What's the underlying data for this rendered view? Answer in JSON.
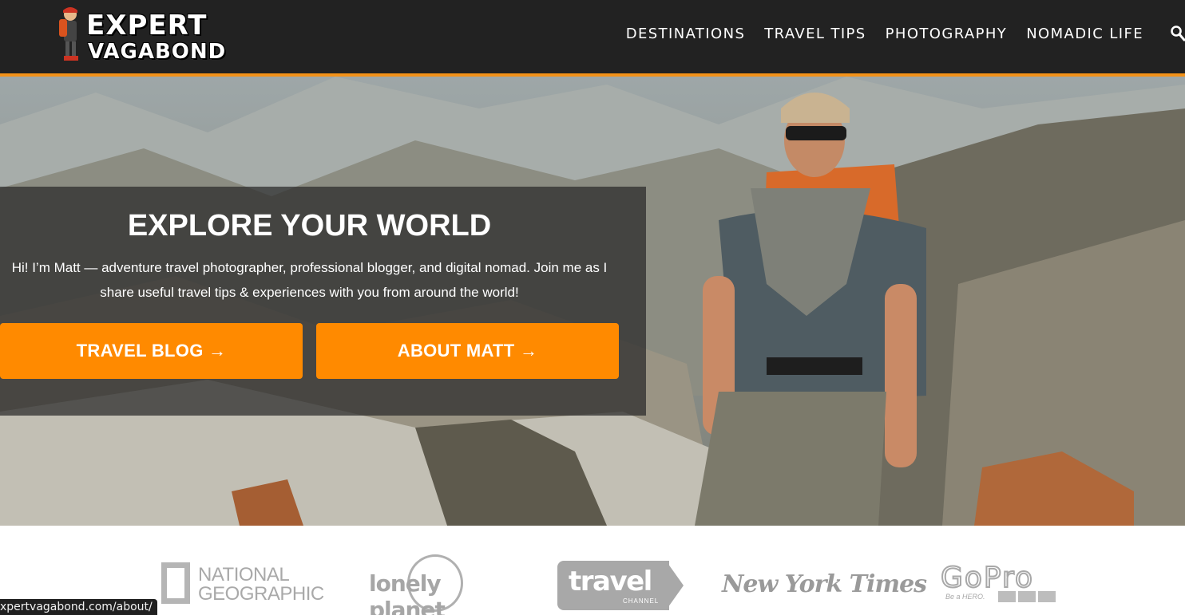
{
  "header": {
    "logo": {
      "line1": "EXPERT",
      "line2": "VAGABOND"
    },
    "nav": [
      {
        "label": "DESTINATIONS"
      },
      {
        "label": "TRAVEL TIPS"
      },
      {
        "label": "PHOTOGRAPHY"
      },
      {
        "label": "NOMADIC LIFE"
      }
    ],
    "search_icon": "search-icon"
  },
  "hero": {
    "title": "EXPLORE YOUR WORLD",
    "text": "Hi! I’m Matt — adventure travel photographer, professional blogger, and digital nomad. Join me as I share useful travel tips & experiences with you from around the world!",
    "buttons": {
      "blog": "TRAVEL BLOG →",
      "about": "ABOUT MATT →"
    }
  },
  "press": {
    "national_geographic": {
      "line1": "NATIONAL",
      "line2": "GEOGRAPHIC"
    },
    "lonely_planet": "lonely planet",
    "travel_channel": {
      "name": "travel",
      "sub": "CHANNEL"
    },
    "nyt": "New York Times",
    "gopro": {
      "name": "GoPro",
      "tag": "Be a HERO."
    }
  },
  "status_bar": {
    "url": "xpertvagabond.com/about/"
  },
  "colors": {
    "header_bg": "#222222",
    "accent": "#f39219",
    "button": "#ff8a00"
  }
}
